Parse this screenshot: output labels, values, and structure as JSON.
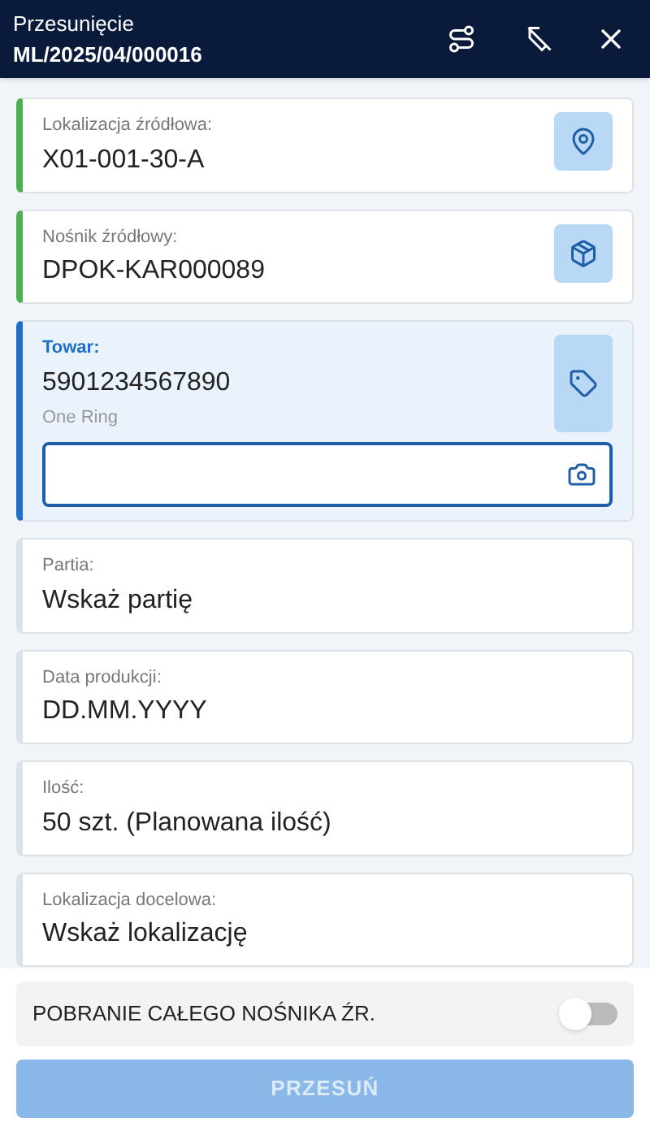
{
  "header": {
    "title": "Przesunięcie",
    "document": "ML/2025/04/000016"
  },
  "fields": [
    {
      "kind": "location",
      "label": "Lokalizacja źródłowa:",
      "value": "X01-001-30-A",
      "completed": true,
      "selected": false
    },
    {
      "kind": "carrier",
      "label": "Nośnik źródłowy:",
      "value": "DPOK-KAR000089",
      "completed": true,
      "selected": false
    },
    {
      "kind": "product",
      "label": "Towar:",
      "value": "5901234567890",
      "subtitle": "One Ring",
      "completed": false,
      "selected": true
    },
    {
      "kind": "plain",
      "label": "Partia:",
      "value": "Wskaż partię",
      "completed": false,
      "selected": false
    },
    {
      "kind": "plain",
      "label": "Data produkcji:",
      "value": "DD.MM.YYYY",
      "completed": false,
      "selected": false
    },
    {
      "kind": "plain",
      "label": "Ilość:",
      "value": "50 szt. (Planowana ilość)",
      "completed": false,
      "selected": false
    },
    {
      "kind": "plain",
      "label": "Lokalizacja docelowa:",
      "value": "Wskaż lokalizację",
      "completed": false,
      "selected": false
    }
  ],
  "toggle": {
    "label": "POBRANIE CAŁEGO NOŚNIKA ŹR.",
    "on": false
  },
  "submit": {
    "label": "PRZESUŃ",
    "disabled": true
  }
}
